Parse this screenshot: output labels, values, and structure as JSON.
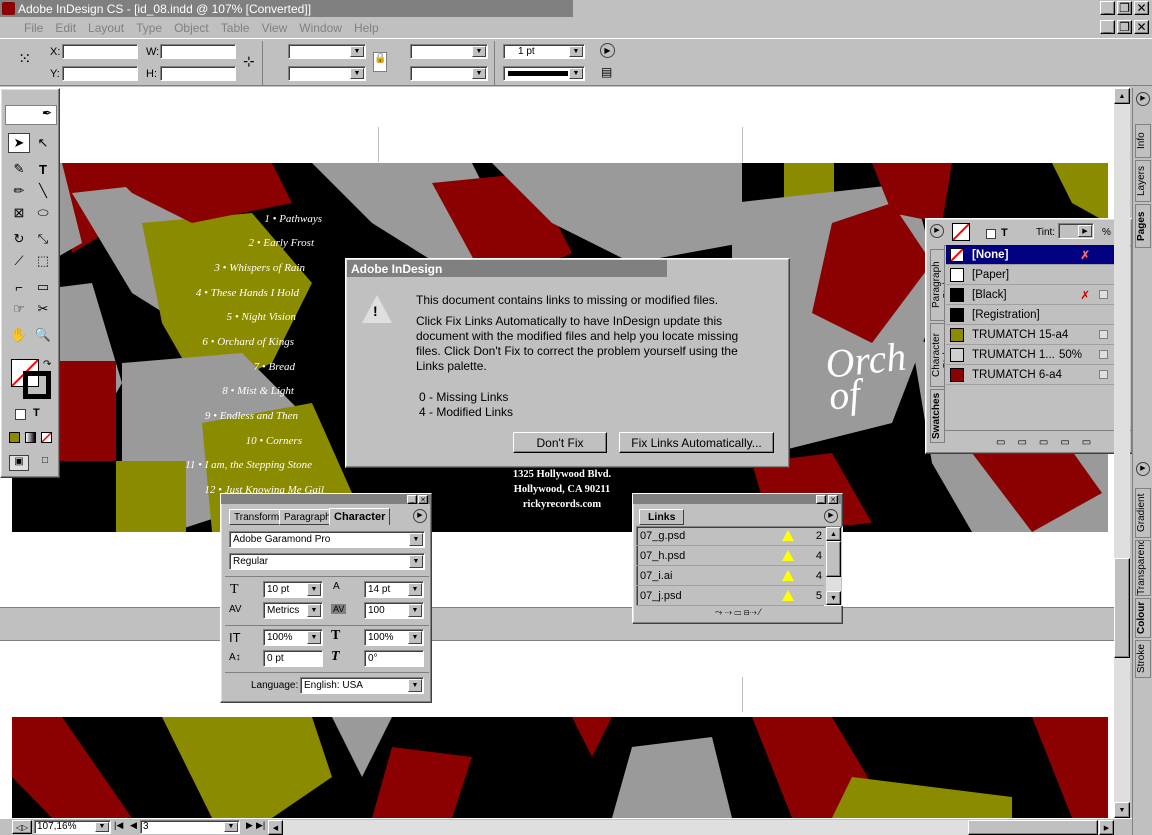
{
  "app": {
    "title": "Adobe InDesign CS - [id_08.indd @ 107% [Converted]]"
  },
  "menu": [
    "File",
    "Edit",
    "Layout",
    "Type",
    "Object",
    "Table",
    "View",
    "Window",
    "Help"
  ],
  "control": {
    "x_label": "X:",
    "y_label": "Y:",
    "w_label": "W:",
    "h_label": "H:",
    "stroke_weight": "1 pt"
  },
  "album": {
    "songs": [
      "1 • Pathways",
      "2 • Early Frost",
      "3 • Whispers of Rain",
      "4 • These Hands I Hold",
      "5 • Night Vision",
      "6 • Orchard of Kings",
      "7 • Bread",
      "8 • Mist & Light",
      "9 • Endless and Then",
      "10 • Corners",
      "11 • I am, the Stepping Stone",
      "12 • Just Knowing Me Gail"
    ],
    "address": [
      "1325 Hollywood Blvd.",
      "Hollywood, CA 90211",
      "rickyrecords.com"
    ],
    "title_art": "Orch of"
  },
  "dialog": {
    "title": "Adobe InDesign",
    "msg1": "This document contains links to missing or modified files.",
    "msg2": "Click Fix Links Automatically to have InDesign update this document with the modified files and help you locate missing files. Click Don't Fix to correct the problem yourself using the Links palette.",
    "missing": "0 - Missing Links",
    "modified": "4 - Modified Links",
    "dont_fix": "Don't Fix",
    "fix_auto": "Fix Links Automatically..."
  },
  "character": {
    "tabs": [
      "Transform",
      "Paragraph",
      "Character"
    ],
    "font": "Adobe Garamond Pro",
    "style": "Regular",
    "size": "10 pt",
    "leading": "14 pt",
    "kerning": "Metrics",
    "tracking": "100",
    "vscale": "100%",
    "hscale": "100%",
    "baseline": "0 pt",
    "skew": "0°",
    "language_label": "Language:",
    "language": "English: USA"
  },
  "links": {
    "tab": "Links",
    "items": [
      {
        "name": "07_g.psd",
        "page": "2"
      },
      {
        "name": "07_h.psd",
        "page": "4"
      },
      {
        "name": "07_i.ai",
        "page": "4"
      },
      {
        "name": "07_j.psd",
        "page": "5"
      }
    ]
  },
  "swatches": {
    "tint_label": "Tint:",
    "pct": "%",
    "side_tabs": [
      "Swatches",
      "Character Styles",
      "Paragraph Styles"
    ],
    "items": [
      {
        "name": "[None]",
        "color": "#ffffff",
        "selected": true
      },
      {
        "name": "[Paper]",
        "color": "#ffffff"
      },
      {
        "name": "[Black]",
        "color": "#000000"
      },
      {
        "name": "[Registration]",
        "color": "#000000"
      },
      {
        "name": "TRUMATCH 15-a4",
        "color": "#8b8b00"
      },
      {
        "name": "TRUMATCH 1...",
        "color": "#d0d0d0",
        "tint": "50%"
      },
      {
        "name": "TRUMATCH 6-a4",
        "color": "#8b0000"
      }
    ]
  },
  "right_tabs": {
    "top": [
      "Info",
      "Layers",
      "Pages"
    ],
    "bottom": [
      "Stroke",
      "Colour",
      "Transparency",
      "Gradient"
    ]
  },
  "status": {
    "zoom": "107,16%",
    "page": "3"
  },
  "colors": {
    "olive": "#8b8b00",
    "red": "#8b0000",
    "gray": "#9a9a9a",
    "navy": "#000080"
  }
}
